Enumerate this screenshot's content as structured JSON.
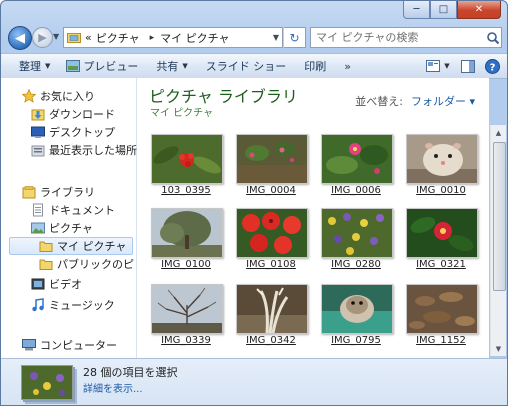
{
  "window": {
    "caption_buttons": {
      "minimize": "─",
      "maximize": "□",
      "close": "✕"
    }
  },
  "nav": {
    "back_icon": "back-arrow-icon",
    "forward_icon": "forward-arrow-icon",
    "address": {
      "prefix": "«",
      "crumbs": [
        "ピクチャ",
        "マイ ピクチャ"
      ],
      "separator": "▸"
    },
    "search_placeholder": "マイ ピクチャの検索"
  },
  "toolbar": {
    "organize": "整理",
    "preview": "プレビュー",
    "share": "共有",
    "slideshow": "スライド ショー",
    "print": "印刷",
    "more": "»"
  },
  "sidebar": {
    "favorites": "お気に入り",
    "downloads": "ダウンロード",
    "desktop": "デスクトップ",
    "recent": "最近表示した場所",
    "libraries": "ライブラリ",
    "documents": "ドキュメント",
    "pictures": "ピクチャ",
    "my_pictures": "マイ ピクチャ",
    "public_pictures": "パブリックのピク",
    "videos": "ビデオ",
    "music": "ミュージック",
    "computer": "コンピューター"
  },
  "content": {
    "library_title": "ピクチャ ライブラリ",
    "library_subtitle": "マイ ピクチャ",
    "arrange_label": "並べ替え:",
    "arrange_value": "フォルダー ▾",
    "photos": [
      "103_0395",
      "IMG_0004",
      "IMG_0006",
      "IMG_0010",
      "IMG_0100",
      "IMG_0108",
      "IMG_0280",
      "IMG_0321",
      "IMG_0339",
      "IMG_0342",
      "IMG_0795",
      "IMG_1152"
    ]
  },
  "details": {
    "selection_text": "28 個の項目を選択",
    "details_link": "詳細を表示..."
  },
  "colors": {
    "accent": "#1d5aa5",
    "library_title": "#1e5e1e",
    "close_button": "#c9452b"
  }
}
